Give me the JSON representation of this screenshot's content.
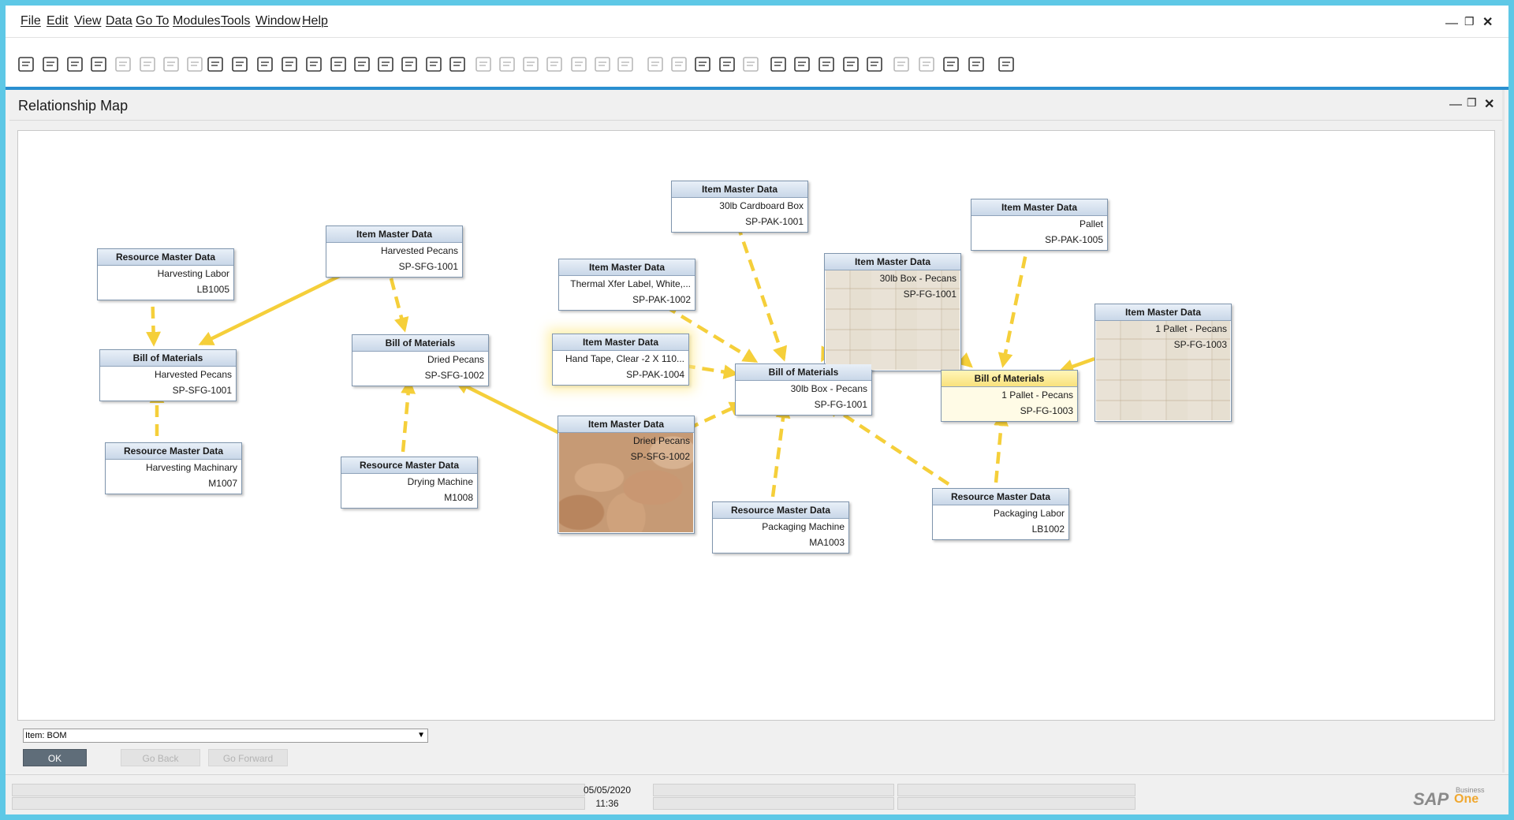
{
  "menu": {
    "items": [
      "File",
      "Edit",
      "View",
      "Data",
      "Go To",
      "Modules",
      "Tools",
      "Window",
      "Help"
    ]
  },
  "window": {
    "title": "Relationship Map"
  },
  "map": {
    "nodes": [
      {
        "id": "res_lb1005",
        "type": "Resource Master Data",
        "desc": "Harvesting Labor",
        "code": "LB1005"
      },
      {
        "id": "item_sfg1001",
        "type": "Item Master Data",
        "desc": "Harvested Pecans",
        "code": "SP-SFG-1001"
      },
      {
        "id": "bom_sfg1001",
        "type": "Bill of Materials",
        "desc": "Harvested Pecans",
        "code": "SP-SFG-1001"
      },
      {
        "id": "res_m1007",
        "type": "Resource Master Data",
        "desc": "Harvesting Machinary",
        "code": "M1007"
      },
      {
        "id": "bom_sfg1002",
        "type": "Bill of Materials",
        "desc": "Dried Pecans",
        "code": "SP-SFG-1002"
      },
      {
        "id": "res_m1008",
        "type": "Resource Master Data",
        "desc": "Drying Machine",
        "code": "M1008"
      },
      {
        "id": "item_pak1002",
        "type": "Item Master Data",
        "desc": "Thermal Xfer Label, White,...",
        "code": "SP-PAK-1002"
      },
      {
        "id": "item_pak1004",
        "type": "Item Master Data",
        "desc": "Hand Tape, Clear -2 X 110...",
        "code": "SP-PAK-1004"
      },
      {
        "id": "item_sfg1002",
        "type": "Item Master Data",
        "desc": "Dried Pecans",
        "code": "SP-SFG-1002"
      },
      {
        "id": "item_pak1001",
        "type": "Item Master Data",
        "desc": "30lb Cardboard Box",
        "code": "SP-PAK-1001"
      },
      {
        "id": "item_fg1001",
        "type": "Item Master Data",
        "desc": "30lb Box - Pecans",
        "code": "SP-FG-1001"
      },
      {
        "id": "bom_fg1001",
        "type": "Bill of Materials",
        "desc": "30lb Box - Pecans",
        "code": "SP-FG-1001"
      },
      {
        "id": "res_ma1003",
        "type": "Resource Master Data",
        "desc": "Packaging Machine",
        "code": "MA1003"
      },
      {
        "id": "item_pak1005",
        "type": "Item Master Data",
        "desc": "Pallet",
        "code": "SP-PAK-1005"
      },
      {
        "id": "bom_fg1003",
        "type": "Bill of Materials",
        "desc": "1 Pallet - Pecans",
        "code": "SP-FG-1003"
      },
      {
        "id": "item_fg1003",
        "type": "Item Master Data",
        "desc": "1 Pallet - Pecans",
        "code": "SP-FG-1003"
      },
      {
        "id": "res_lb1002",
        "type": "Resource Master Data",
        "desc": "Packaging Labor",
        "code": "LB1002"
      }
    ]
  },
  "controls": {
    "combo_value": "Item: BOM",
    "ok_label": "OK",
    "back_label": "Go Back",
    "forward_label": "Go Forward"
  },
  "status": {
    "date": "05/05/2020",
    "time": "11:36"
  },
  "brand": {
    "sap": "SAP",
    "business": "Business",
    "one": "One"
  },
  "colors": {
    "edge": "#f5cf3a",
    "accent": "#2a8fd0",
    "selected_header": "#f9e27c"
  }
}
